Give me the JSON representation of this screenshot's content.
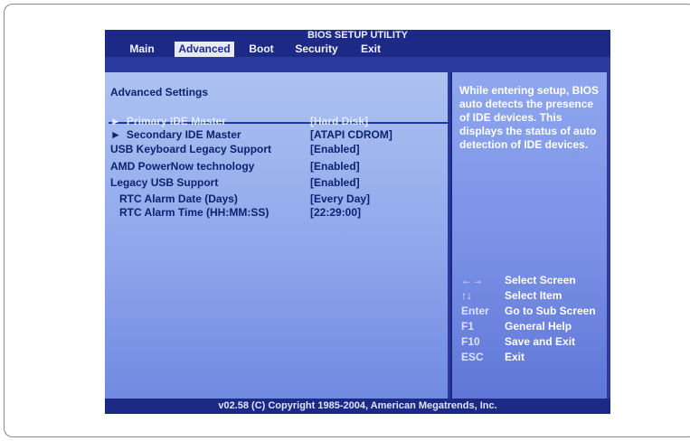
{
  "title": "BIOS SETUP UTILITY",
  "menu": [
    {
      "label": "Main",
      "active": false
    },
    {
      "label": "Advanced",
      "active": true
    },
    {
      "label": "Boot",
      "active": false
    },
    {
      "label": "Security",
      "active": false
    },
    {
      "label": "Exit",
      "active": false
    }
  ],
  "section_title": "Advanced Settings",
  "settings": [
    {
      "arrow": "►",
      "label": "Primary IDE Master",
      "value": "[Hard Disk]",
      "selected": true,
      "indent": false
    },
    {
      "arrow": "►",
      "label": "Secondary IDE Master",
      "value": "[ATAPI CDROM]",
      "selected": false,
      "indent": false
    },
    {
      "arrow": "",
      "label": "USB Keyboard Legacy Support",
      "value": "[Enabled]",
      "selected": false,
      "indent": false
    },
    {
      "arrow": "",
      "label": "AMD PowerNow technology",
      "value": "[Enabled]",
      "selected": false,
      "indent": false
    },
    {
      "arrow": "",
      "label": "Legacy USB Support",
      "value": "[Enabled]",
      "selected": false,
      "indent": false
    },
    {
      "arrow": "",
      "label": "RTC Alarm Date (Days)",
      "value": "[Every Day]",
      "selected": false,
      "indent": true
    },
    {
      "arrow": "",
      "label": "RTC Alarm Time (HH:MM:SS)",
      "value": "[22:29:00]",
      "selected": false,
      "indent": true
    }
  ],
  "help": "While entering setup, BIOS auto detects the presence of IDE devices. This displays the status of auto detection of IDE devices.",
  "keys": [
    {
      "key": "←→",
      "desc": "Select Screen"
    },
    {
      "key": "↑↓",
      "desc": "Select Item"
    },
    {
      "key": "Enter",
      "desc": "Go to Sub Screen"
    },
    {
      "key": "F1",
      "desc": "General Help"
    },
    {
      "key": "F10",
      "desc": "Save and Exit"
    },
    {
      "key": "ESC",
      "desc": "Exit"
    }
  ],
  "footer": "v02.58 (C) Copyright 1985-2004, American Megatrends, Inc.",
  "colors": {
    "title_bar": "#1c2a86",
    "active_tab": "#e7ebf6",
    "main_panel": "#9bb0ee",
    "text": "#0b2370"
  }
}
